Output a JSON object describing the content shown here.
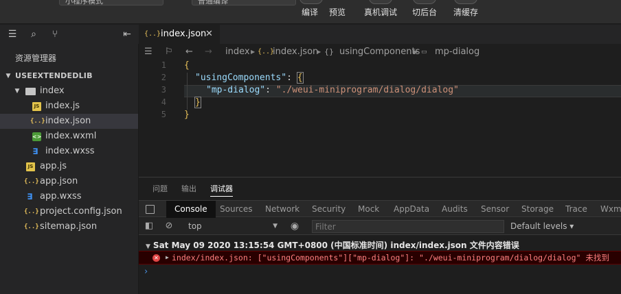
{
  "toolbar": {
    "mode_select": "小程序模式",
    "compile_select": "普通编译",
    "buttons": {
      "compile": "编译",
      "preview": "预览",
      "remote_debug": "真机调试",
      "background": "切后台",
      "clear_cache": "清缓存"
    }
  },
  "sidebar": {
    "title": "资源管理器",
    "project": "USEEXTENDEDLIB",
    "folder": "index",
    "files_in_folder": [
      "index.js",
      "index.json",
      "index.wxml",
      "index.wxss"
    ],
    "root_files": [
      "app.js",
      "app.json",
      "app.wxss",
      "project.config.json",
      "sitemap.json"
    ]
  },
  "editor": {
    "tab_label": "index.json",
    "breadcrumb": [
      "index",
      "index.json",
      "usingComponents",
      "mp-dialog"
    ],
    "lines": [
      "1",
      "2",
      "3",
      "4",
      "5"
    ],
    "code": {
      "open_brace": "{",
      "key1": "\"usingComponents\"",
      "colon1": ": ",
      "open_brace2": "{",
      "key2": "\"mp-dialog\"",
      "colon2": ": ",
      "value2": "\"./weui-miniprogram/dialog/dialog\"",
      "close_brace2": "}",
      "close_brace": "}"
    }
  },
  "panel": {
    "tabs": [
      "问题",
      "输出",
      "调试器"
    ],
    "devtools_tabs": [
      "Console",
      "Sources",
      "Network",
      "Security",
      "Mock",
      "AppData",
      "Audits",
      "Sensor",
      "Storage",
      "Trace",
      "Wxml"
    ],
    "context": "top",
    "filter_placeholder": "Filter",
    "levels": "Default levels ▾",
    "log_group": "Sat May 09 2020 13:15:54 GMT+0800 (中国标准时间)  index/index.json 文件内容错误",
    "error_text": "index/index.json: [\"usingComponents\"][\"mp-dialog\"]: \"./weui-miniprogram/dialog/dialog\" 未找到",
    "prompt": "›"
  }
}
